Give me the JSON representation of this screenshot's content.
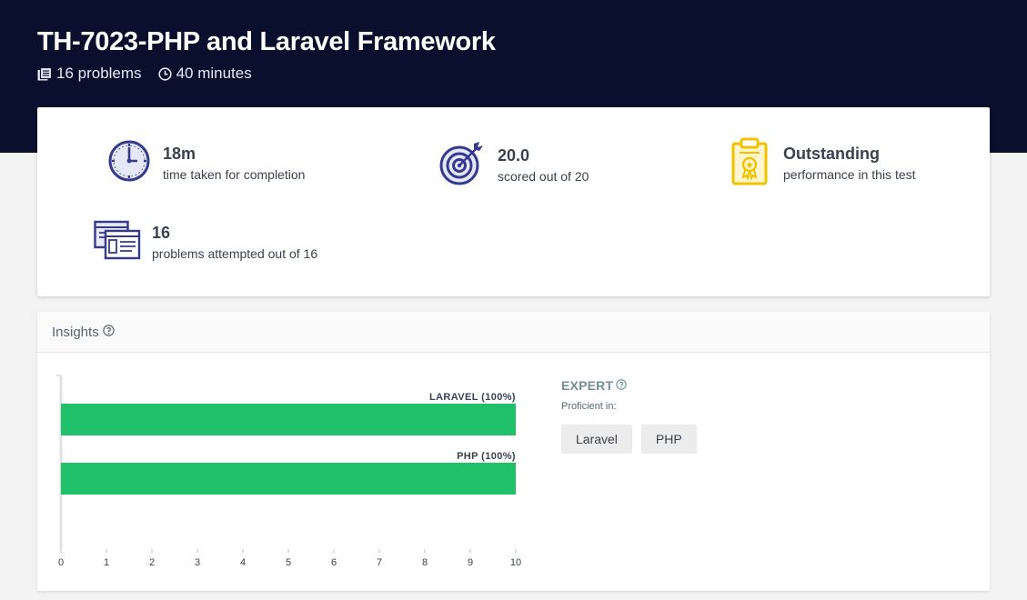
{
  "header": {
    "title": "TH-7023-PHP and Laravel Framework",
    "problems": "16 problems",
    "duration": "40 minutes"
  },
  "stats": [
    {
      "value": "18m",
      "label": "time taken for completion",
      "icon": "clock-icon"
    },
    {
      "value": "20.0",
      "label": "scored out of 20",
      "icon": "target-icon"
    },
    {
      "value": "Outstanding",
      "label": "performance in this test",
      "icon": "clipboard-badge-icon"
    },
    {
      "value": "16",
      "label": "problems attempted out of 16",
      "icon": "windows-icon"
    }
  ],
  "insights": {
    "title": "Insights",
    "level": "EXPERT",
    "proficient_label": "Proficient in:",
    "tags": [
      "Laravel",
      "PHP"
    ]
  },
  "chart_data": {
    "type": "bar",
    "orientation": "horizontal",
    "categories": [
      "LARAVEL (100%)",
      "PHP (100%)"
    ],
    "values": [
      10,
      10
    ],
    "xlim": [
      0,
      10
    ],
    "xticks": [
      "0",
      "1",
      "2",
      "3",
      "4",
      "5",
      "6",
      "7",
      "8",
      "9",
      "10"
    ],
    "grid": false,
    "bar_color": "#1fc16b"
  },
  "colors": {
    "header_bg": "#0b0f2e",
    "icon_primary": "#333a8f",
    "icon_accent": "#f2c200",
    "bar": "#1fc16b"
  }
}
